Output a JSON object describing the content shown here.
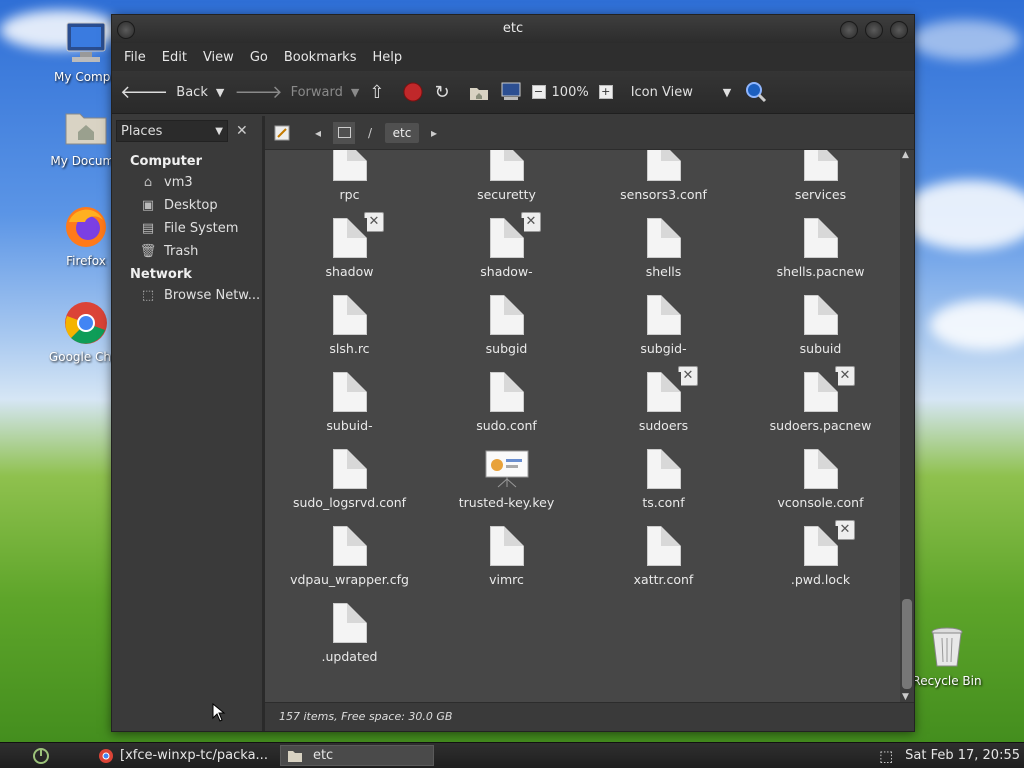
{
  "desktop": {
    "icons": [
      {
        "label": "My Compu"
      },
      {
        "label": "My Docume"
      },
      {
        "label": "Firefox"
      },
      {
        "label": "Google Chro"
      },
      {
        "label": "Recycle Bin"
      }
    ]
  },
  "window": {
    "title": "etc",
    "menu": [
      "File",
      "Edit",
      "View",
      "Go",
      "Bookmarks",
      "Help"
    ],
    "toolbar": {
      "back": "Back",
      "forward": "Forward",
      "zoom": "100%",
      "view_mode": "Icon View"
    },
    "sidebar": {
      "selector": "Places",
      "sections": [
        {
          "title": "Computer",
          "items": [
            {
              "label": "vm3",
              "icon": "home-icon"
            },
            {
              "label": "Desktop",
              "icon": "desktop-icon"
            },
            {
              "label": "File System",
              "icon": "drive-icon"
            },
            {
              "label": "Trash",
              "icon": "trash-icon"
            }
          ]
        },
        {
          "title": "Network",
          "items": [
            {
              "label": "Browse Netw...",
              "icon": "network-icon"
            }
          ]
        }
      ]
    },
    "path": {
      "root": "/",
      "current": "etc"
    },
    "files": [
      {
        "name": "rpc"
      },
      {
        "name": "securetty"
      },
      {
        "name": "sensors3.conf"
      },
      {
        "name": "services"
      },
      {
        "name": "shadow",
        "locked": true
      },
      {
        "name": "shadow-",
        "locked": true
      },
      {
        "name": "shells"
      },
      {
        "name": "shells.pacnew"
      },
      {
        "name": "slsh.rc"
      },
      {
        "name": "subgid"
      },
      {
        "name": "subgid-"
      },
      {
        "name": "subuid"
      },
      {
        "name": "subuid-"
      },
      {
        "name": "sudo.conf"
      },
      {
        "name": "sudoers",
        "locked": true
      },
      {
        "name": "sudoers.pacnew",
        "locked": true
      },
      {
        "name": "sudo_logsrvd.conf"
      },
      {
        "name": "trusted-key.key",
        "type": "presentation"
      },
      {
        "name": "ts.conf"
      },
      {
        "name": "vconsole.conf"
      },
      {
        "name": "vdpau_wrapper.cfg"
      },
      {
        "name": "vimrc"
      },
      {
        "name": "xattr.conf"
      },
      {
        "name": ".pwd.lock",
        "locked": true
      },
      {
        "name": ".updated"
      }
    ],
    "status": "157 items, Free space: 30.0 GB"
  },
  "taskbar": {
    "tasks": [
      {
        "label": "[xfce-winxp-tc/packa..."
      },
      {
        "label": "etc"
      }
    ],
    "clock": "Sat Feb 17, 20:55"
  }
}
